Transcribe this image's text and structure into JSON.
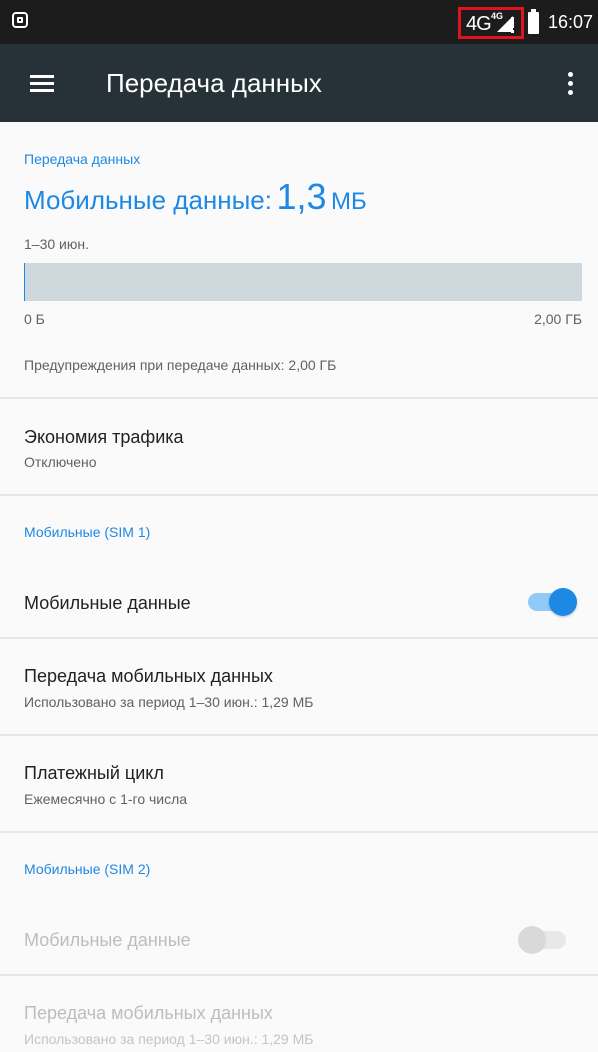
{
  "status_bar": {
    "network_type": "4G",
    "network_badge": "4G",
    "time": "16:07"
  },
  "toolbar": {
    "title": "Передача данных"
  },
  "data_usage": {
    "section_header": "Передача данных",
    "mobile_label": "Мобильные данные:",
    "mobile_value": "1,3",
    "mobile_unit": "МБ",
    "period": "1–30 июн.",
    "bar_min": "0 Б",
    "bar_max": "2,00 ГБ",
    "used_fraction": 0.0006,
    "warning": "Предупреждения при передаче данных: 2,00 ГБ"
  },
  "data_saver": {
    "title": "Экономия трафика",
    "status": "Отключено"
  },
  "sim1": {
    "header": "Мобильные (SIM 1)",
    "mobile_data_label": "Мобильные данные",
    "mobile_data_enabled": true,
    "usage_title": "Передача мобильных данных",
    "usage_summary": "Использовано за период 1–30 июн.: 1,29 МБ",
    "billing_title": "Платежный цикл",
    "billing_summary": "Ежемесячно с 1-го числа"
  },
  "sim2": {
    "header": "Мобильные (SIM 2)",
    "mobile_data_label": "Мобильные данные",
    "mobile_data_enabled": false,
    "usage_title": "Передача мобильных данных",
    "usage_summary": "Использовано за период 1–30 июн.: 1,29 МБ"
  },
  "colors": {
    "accent": "#1e88e5",
    "toolbar": "#263238",
    "status_bar": "#1c1c1c",
    "highlight_box": "#e0141e"
  }
}
